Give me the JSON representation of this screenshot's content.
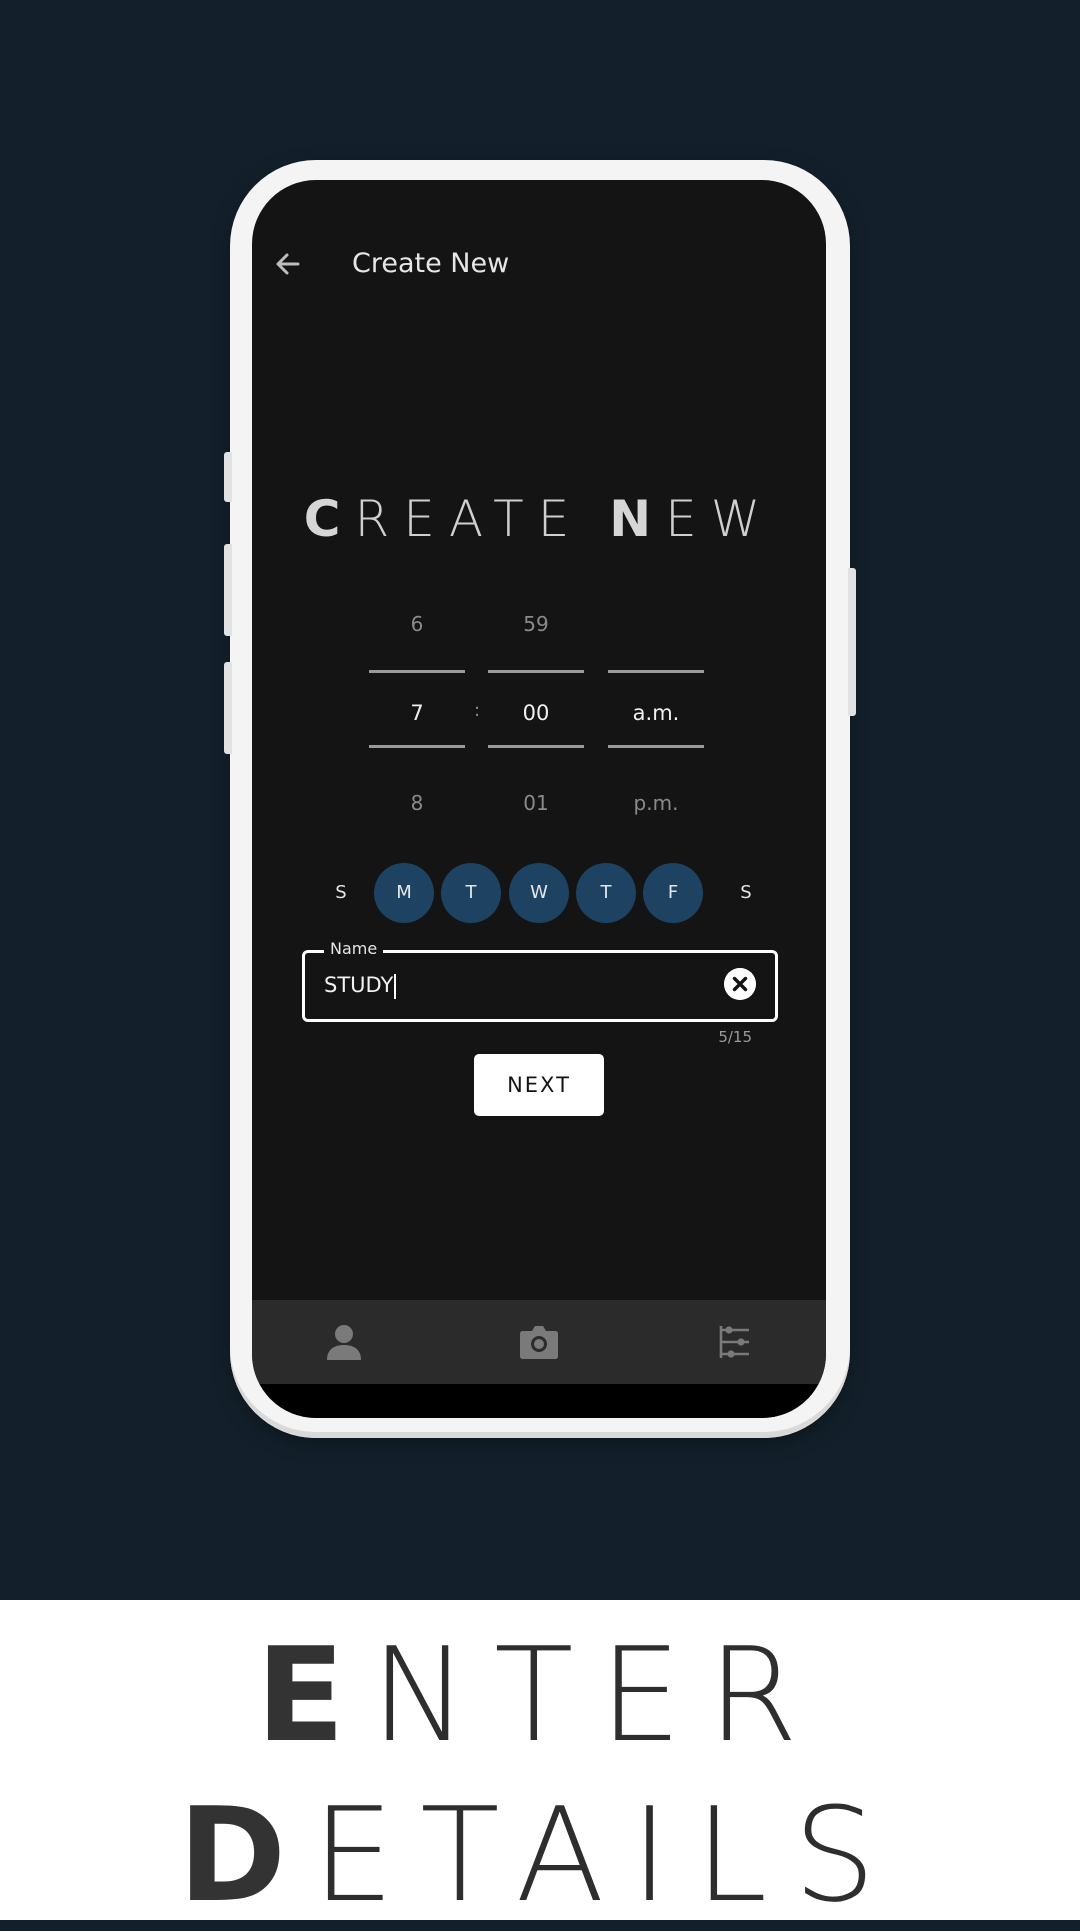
{
  "app_bar": {
    "title": "Create New"
  },
  "hero": {
    "title_first": "CREATE",
    "title_second": "NEW"
  },
  "time_picker": {
    "hour": {
      "prev": "6",
      "selected": "7",
      "next": "8"
    },
    "separator": ":",
    "minute": {
      "prev": "59",
      "selected": "00",
      "next": "01"
    },
    "period": {
      "prev": "",
      "selected": "a.m.",
      "next": "p.m."
    }
  },
  "days": [
    {
      "label": "S",
      "selected": false
    },
    {
      "label": "M",
      "selected": true
    },
    {
      "label": "T",
      "selected": true
    },
    {
      "label": "W",
      "selected": true
    },
    {
      "label": "T",
      "selected": true
    },
    {
      "label": "F",
      "selected": true
    },
    {
      "label": "S",
      "selected": false
    }
  ],
  "name_field": {
    "label": "Name",
    "value": "STUDY",
    "counter": "5/15"
  },
  "next_button": {
    "label": "NEXT"
  },
  "bottom_nav": [
    {
      "icon": "person-icon"
    },
    {
      "icon": "camera-icon"
    },
    {
      "icon": "settings-sliders-icon"
    }
  ],
  "caption": {
    "line1": "ENTER",
    "line2": "DETAILS"
  },
  "colors": {
    "background": "#13202b",
    "day_selected": "#1d4262",
    "screen": "#141414"
  }
}
